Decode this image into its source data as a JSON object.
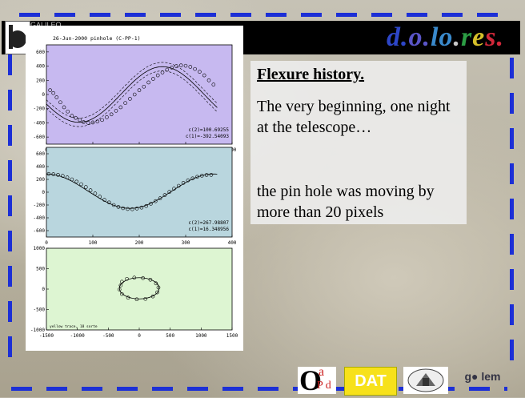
{
  "header": {
    "brand_letters": [
      {
        "ch": "d.",
        "color": "#2d46c8"
      },
      {
        "ch": "o.",
        "color": "#5a55c8"
      },
      {
        "ch": "lo",
        "color": "#3a8acc"
      },
      {
        "ch": ".",
        "color": "#c8c8c8"
      },
      {
        "ch": "r",
        "color": "#2c9e44"
      },
      {
        "ch": "e",
        "color": "#d6c02a"
      },
      {
        "ch": "s.",
        "color": "#d2283a"
      }
    ],
    "logo_caption": "GALILEO"
  },
  "text": {
    "title": "Flexure history.",
    "p1": "The very beginning, one night at the telescope…",
    "p2": "the pin hole was moving by more than 20 pixels"
  },
  "chart_data": [
    {
      "type": "scatter",
      "title": "26-Jun-2000 pinhole (C-PP-1)",
      "background": "#c7b9f0",
      "xlim": [
        0,
        400
      ],
      "ylim": [
        -700,
        700
      ],
      "xticks": [
        0,
        100,
        200,
        300,
        400
      ],
      "yticks": [
        -600,
        -400,
        -200,
        0,
        200,
        400,
        600
      ],
      "annotations": [
        "c(2)=100.69255",
        "c(1)=-392.54093"
      ],
      "fit": {
        "amplitude": 392.5,
        "offset": 0,
        "phase_deg": 200,
        "band": 60
      },
      "points": [
        [
          8,
          60
        ],
        [
          15,
          20
        ],
        [
          22,
          -40
        ],
        [
          30,
          -110
        ],
        [
          38,
          -180
        ],
        [
          46,
          -240
        ],
        [
          55,
          -300
        ],
        [
          63,
          -330
        ],
        [
          72,
          -360
        ],
        [
          80,
          -390
        ],
        [
          90,
          -400
        ],
        [
          100,
          -395
        ],
        [
          110,
          -380
        ],
        [
          120,
          -360
        ],
        [
          130,
          -320
        ],
        [
          140,
          -280
        ],
        [
          150,
          -230
        ],
        [
          160,
          -180
        ],
        [
          170,
          -120
        ],
        [
          180,
          -60
        ],
        [
          190,
          0
        ],
        [
          200,
          60
        ],
        [
          210,
          110
        ],
        [
          220,
          170
        ],
        [
          230,
          220
        ],
        [
          240,
          270
        ],
        [
          250,
          310
        ],
        [
          260,
          350
        ],
        [
          270,
          380
        ],
        [
          280,
          400
        ],
        [
          290,
          410
        ],
        [
          300,
          405
        ],
        [
          310,
          390
        ],
        [
          320,
          360
        ],
        [
          330,
          320
        ],
        [
          340,
          270
        ],
        [
          350,
          200
        ],
        [
          360,
          140
        ]
      ]
    },
    {
      "type": "scatter",
      "background": "#b9d6de",
      "xlim": [
        0,
        400
      ],
      "ylim": [
        -700,
        700
      ],
      "xticks": [
        0,
        100,
        200,
        300,
        400
      ],
      "yticks": [
        -600,
        -400,
        -200,
        0,
        200,
        400,
        600
      ],
      "annotations": [
        "c(2)=267.98807",
        "c(1)=16.348956"
      ],
      "fit": {
        "amplitude": 268,
        "offset": 16,
        "phase_deg": 90,
        "band": 0
      },
      "points": [
        [
          5,
          285
        ],
        [
          15,
          280
        ],
        [
          25,
          270
        ],
        [
          35,
          255
        ],
        [
          45,
          230
        ],
        [
          55,
          200
        ],
        [
          65,
          165
        ],
        [
          75,
          125
        ],
        [
          85,
          80
        ],
        [
          95,
          30
        ],
        [
          105,
          -20
        ],
        [
          115,
          -70
        ],
        [
          125,
          -120
        ],
        [
          135,
          -160
        ],
        [
          145,
          -200
        ],
        [
          155,
          -230
        ],
        [
          165,
          -250
        ],
        [
          175,
          -262
        ],
        [
          185,
          -265
        ],
        [
          195,
          -255
        ],
        [
          205,
          -240
        ],
        [
          215,
          -215
        ],
        [
          225,
          -180
        ],
        [
          235,
          -140
        ],
        [
          245,
          -95
        ],
        [
          255,
          -45
        ],
        [
          265,
          5
        ],
        [
          275,
          55
        ],
        [
          285,
          100
        ],
        [
          295,
          145
        ],
        [
          305,
          185
        ],
        [
          315,
          215
        ],
        [
          325,
          240
        ],
        [
          335,
          258
        ],
        [
          345,
          268
        ],
        [
          355,
          270
        ]
      ]
    },
    {
      "type": "scatter",
      "background": "#ddf5d2",
      "xlim": [
        -1500,
        1500
      ],
      "ylim": [
        -1000,
        1000
      ],
      "xticks": [
        -1500,
        -1000,
        -500,
        0,
        500,
        1000,
        1500
      ],
      "yticks": [
        -1000,
        -500,
        0,
        500,
        1000
      ],
      "footer": "yellow trace, 18 sorte",
      "ellipse": {
        "cx": 0,
        "cy": 20,
        "rx": 320,
        "ry": 260
      },
      "points": [
        [
          -280,
          180
        ],
        [
          -200,
          250
        ],
        [
          -80,
          280
        ],
        [
          60,
          270
        ],
        [
          180,
          230
        ],
        [
          270,
          140
        ],
        [
          310,
          40
        ],
        [
          290,
          -80
        ],
        [
          220,
          -180
        ],
        [
          100,
          -240
        ],
        [
          -40,
          -250
        ],
        [
          -180,
          -210
        ],
        [
          -280,
          -120
        ],
        [
          -320,
          -10
        ],
        [
          -300,
          90
        ]
      ]
    }
  ],
  "footer": {
    "oapd_big": "O",
    "oapd_a": "a",
    "oapd_pd": "P d",
    "dat_label": "DAT",
    "galem_label": "g● lem"
  }
}
